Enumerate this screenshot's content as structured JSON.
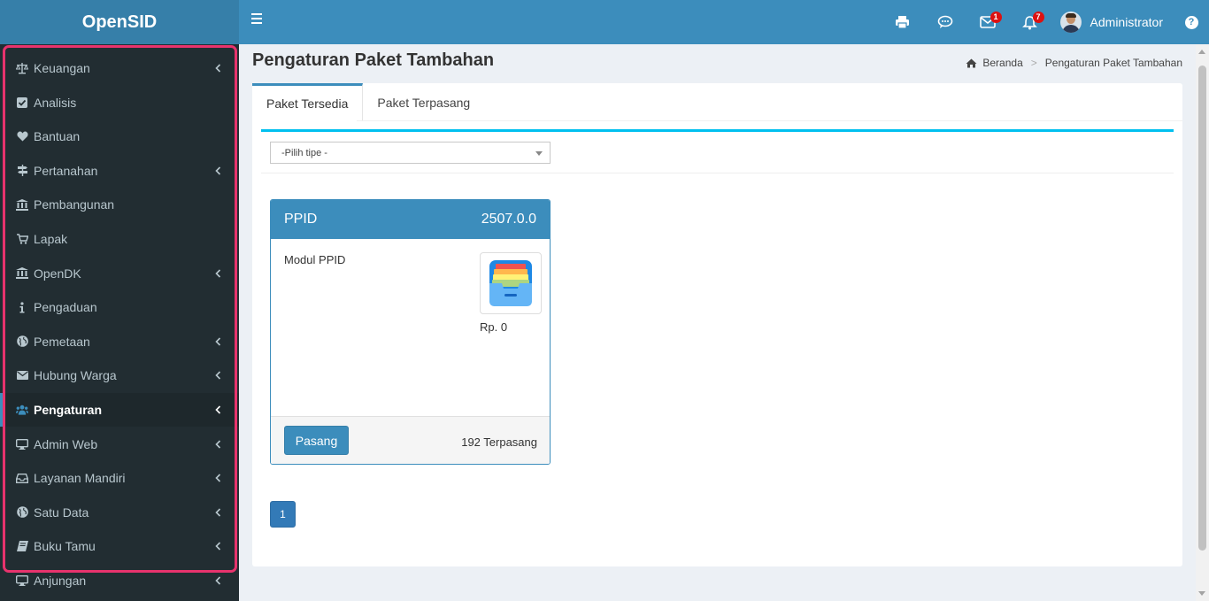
{
  "app": {
    "logo": "OpenSID"
  },
  "header": {
    "user_name": "Administrator",
    "mail_badge": "1",
    "notif_badge": "7",
    "help_label": "?"
  },
  "sidebar": {
    "items": [
      {
        "label": "Keuangan",
        "icon": "balance-scale-icon",
        "has_children": true
      },
      {
        "label": "Analisis",
        "icon": "check-square-icon",
        "has_children": false
      },
      {
        "label": "Bantuan",
        "icon": "heart-icon",
        "has_children": false
      },
      {
        "label": "Pertanahan",
        "icon": "map-signs-icon",
        "has_children": true
      },
      {
        "label": "Pembangunan",
        "icon": "bank-icon",
        "has_children": false
      },
      {
        "label": "Lapak",
        "icon": "cart-icon",
        "has_children": false
      },
      {
        "label": "OpenDK",
        "icon": "bank-icon",
        "has_children": true
      },
      {
        "label": "Pengaduan",
        "icon": "info-icon",
        "has_children": false
      },
      {
        "label": "Pemetaan",
        "icon": "globe-icon",
        "has_children": true
      },
      {
        "label": "Hubung Warga",
        "icon": "envelope-icon",
        "has_children": true
      },
      {
        "label": "Pengaturan",
        "icon": "users-icon",
        "has_children": true,
        "active": true
      },
      {
        "label": "Admin Web",
        "icon": "desktop-icon",
        "has_children": true
      },
      {
        "label": "Layanan Mandiri",
        "icon": "inbox-icon",
        "has_children": true
      },
      {
        "label": "Satu Data",
        "icon": "globe-icon",
        "has_children": true
      },
      {
        "label": "Buku Tamu",
        "icon": "book-icon",
        "has_children": true
      },
      {
        "label": "Anjungan",
        "icon": "desktop-icon",
        "has_children": true
      }
    ]
  },
  "page": {
    "title": "Pengaturan Paket Tambahan",
    "breadcrumb": [
      "Beranda",
      ">",
      "Pengaturan Paket Tambahan"
    ]
  },
  "tabs": [
    {
      "label": "Paket Tersedia",
      "active": true
    },
    {
      "label": "Paket Terpasang",
      "active": false
    }
  ],
  "filter": {
    "selected": "-Pilih tipe -"
  },
  "package": {
    "name": "PPID",
    "version": "2507.0.0",
    "description": "Modul PPID",
    "price": "Rp. 0",
    "install_button": "Pasang",
    "installed_count": "192 Terpasang"
  },
  "pagination": {
    "current": "1"
  },
  "colors": {
    "header": "#3c8dbc",
    "logo_bg": "#367fa9",
    "sidebar": "#222d32",
    "accent_tab": "#00c0ef",
    "highlight": "#e8336d"
  }
}
